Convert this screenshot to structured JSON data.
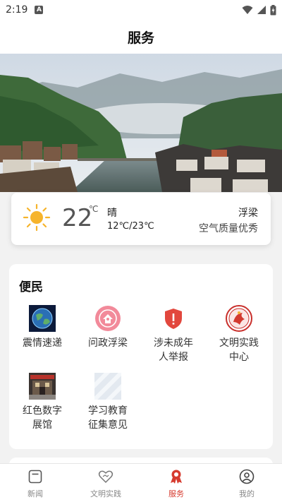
{
  "status_bar": {
    "time": "2:19",
    "notification_badge": "A",
    "icons": [
      "wifi-icon",
      "signal-icon",
      "battery-charging-icon"
    ]
  },
  "header": {
    "title": "服务"
  },
  "weather": {
    "temperature": "22",
    "unit": "℃",
    "condition": "晴",
    "range": "12℃/23℃",
    "city": "浮梁",
    "air_quality": "空气质量优秀",
    "icon": "sun-icon"
  },
  "service": {
    "section_title": "便民",
    "tiles": [
      {
        "label": "震情速递",
        "icon": "earth-globe-icon"
      },
      {
        "label": "问政浮梁",
        "icon": "pink-badge-icon"
      },
      {
        "label": "涉未成年\n人举报",
        "icon": "red-shield-icon"
      },
      {
        "label": "文明实践\n中心",
        "icon": "civilization-emblem-icon"
      },
      {
        "label": "红色数字\n展馆",
        "icon": "museum-building-icon"
      },
      {
        "label": "学习教育\n征集意见",
        "icon": "placeholder-image-icon"
      }
    ]
  },
  "tabs": [
    {
      "label": "新闻",
      "icon": "news-icon",
      "active": false
    },
    {
      "label": "文明实践",
      "icon": "heart-icon",
      "active": false
    },
    {
      "label": "服务",
      "icon": "service-medal-icon",
      "active": true
    },
    {
      "label": "我的",
      "icon": "profile-icon",
      "active": false
    }
  ],
  "colors": {
    "accent": "#d63b2f",
    "background": "#f2f2f2",
    "card": "#ffffff",
    "sun": "#f6b42c"
  }
}
